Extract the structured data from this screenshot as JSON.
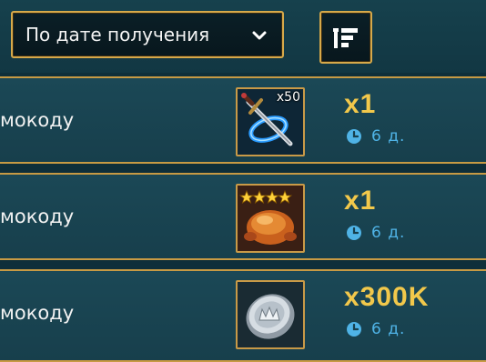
{
  "sort": {
    "selected": "По дате получения",
    "chevron_icon": "chevron-down-icon",
    "order_icon": "sort-order-icon"
  },
  "rewards": [
    {
      "description": "мокоду",
      "item_icon": "sword-portal-icon",
      "item_qty": "x50",
      "amount": "x1",
      "timer": "6 д."
    },
    {
      "description": "мокоду",
      "item_icon": "roast-chicken-icon",
      "stars": 4,
      "amount": "x1",
      "timer": "6 д."
    },
    {
      "description": "мокоду",
      "item_icon": "silver-coin-icon",
      "amount": "x300K",
      "timer": "6 д."
    }
  ],
  "colors": {
    "accent_gold": "#d7a94a",
    "amount_yellow": "#f2c84b",
    "timer_blue": "#4fb3e6",
    "row_bg": "#1b4856"
  }
}
